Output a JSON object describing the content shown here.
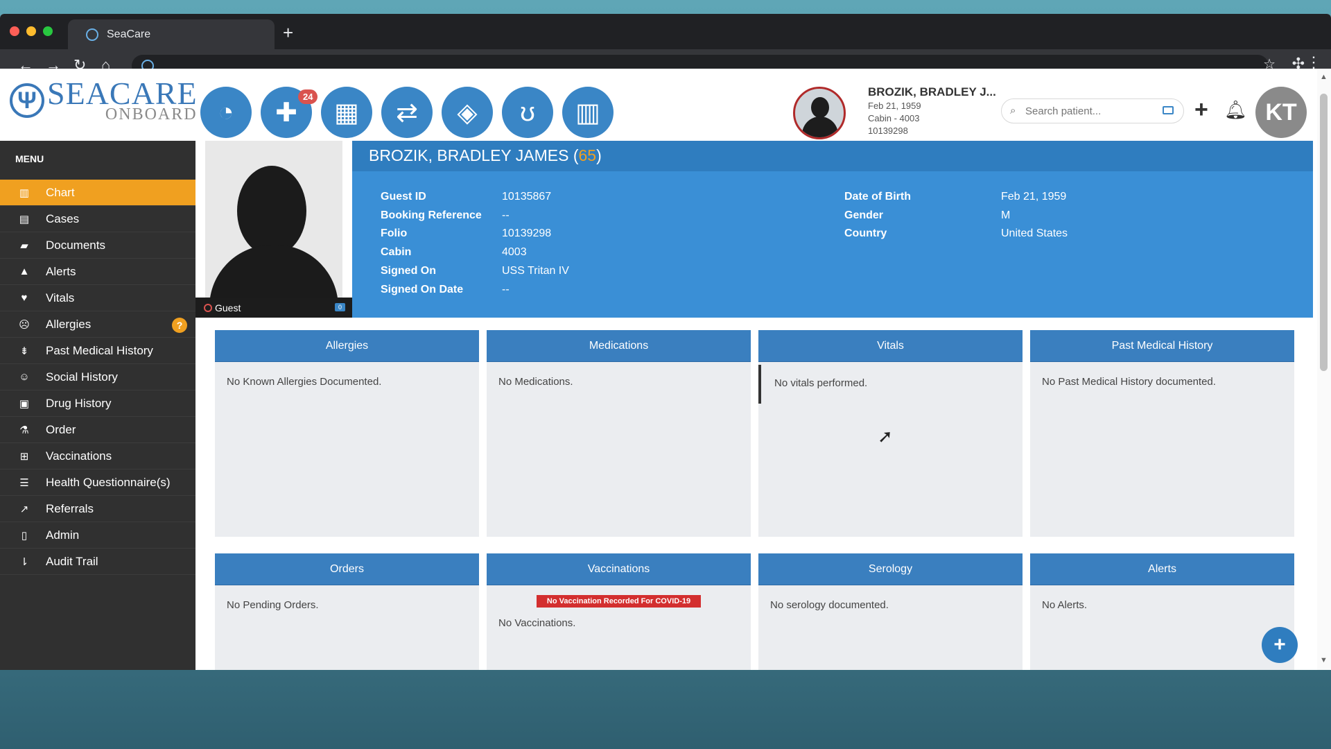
{
  "browser": {
    "tab_title": "SeaCare",
    "new_tab": "+"
  },
  "logo": {
    "name": "SEACARE",
    "sub": "ONBOARD"
  },
  "header": {
    "notification_count": "24",
    "patient_name": "BROZIK, BRADLEY J...",
    "patient_dob": "Feb 21, 1959",
    "patient_cabin": "Cabin - 4003",
    "patient_id": "10139298",
    "search_placeholder": "Search patient...",
    "user_initials": "KT"
  },
  "sidebar": {
    "title": "MENU",
    "items": [
      {
        "label": "Chart",
        "icon": "bar-chart-icon"
      },
      {
        "label": "Cases",
        "icon": "archive-icon"
      },
      {
        "label": "Documents",
        "icon": "folder-icon"
      },
      {
        "label": "Alerts",
        "icon": "warning-icon"
      },
      {
        "label": "Vitals",
        "icon": "heart-icon"
      },
      {
        "label": "Allergies",
        "icon": "face-icon",
        "badge": "?"
      },
      {
        "label": "Past Medical History",
        "icon": "sort-icon"
      },
      {
        "label": "Social History",
        "icon": "smile-icon"
      },
      {
        "label": "Drug History",
        "icon": "medkit-icon"
      },
      {
        "label": "Order",
        "icon": "flask-icon"
      },
      {
        "label": "Vaccinations",
        "icon": "plus-square-icon"
      },
      {
        "label": "Health Questionnaire(s)",
        "icon": "list-icon"
      },
      {
        "label": "Referrals",
        "icon": "share-icon"
      },
      {
        "label": "Admin",
        "icon": "file-icon"
      },
      {
        "label": "Audit Trail",
        "icon": "audit-icon"
      }
    ]
  },
  "patient": {
    "status": "Guest",
    "chip": "0",
    "name": "BROZIK, BRADLEY JAMES",
    "age": "65",
    "left_fields": [
      {
        "label": "Guest ID",
        "value": "10135867"
      },
      {
        "label": "Booking Reference",
        "value": "--"
      },
      {
        "label": "Folio",
        "value": "10139298"
      },
      {
        "label": "Cabin",
        "value": "4003"
      },
      {
        "label": "Signed On",
        "value": "USS Tritan IV"
      },
      {
        "label": "Signed On Date",
        "value": "--"
      }
    ],
    "right_fields": [
      {
        "label": "Date of Birth",
        "value": "Feb 21, 1959"
      },
      {
        "label": "Gender",
        "value": "M"
      },
      {
        "label": "Country",
        "value": "United States"
      }
    ]
  },
  "panels": [
    {
      "title": "Allergies",
      "text": "No Known Allergies Documented."
    },
    {
      "title": "Medications",
      "text": "No Medications."
    },
    {
      "title": "Vitals",
      "text": "No vitals performed."
    },
    {
      "title": "Past Medical History",
      "text": "No Past Medical History documented."
    },
    {
      "title": "Orders",
      "text": "No Pending Orders."
    },
    {
      "title": "Vaccinations",
      "badge": "No Vaccination Recorded For COVID-19",
      "text": "No Vaccinations."
    },
    {
      "title": "Serology",
      "text": "No serology documented."
    },
    {
      "title": "Alerts",
      "text": "No Alerts."
    }
  ],
  "colors": {
    "accent": "#f0a020",
    "primary": "#3a86c6",
    "banner": "#3a8fd6",
    "alert": "#d32f2f"
  }
}
